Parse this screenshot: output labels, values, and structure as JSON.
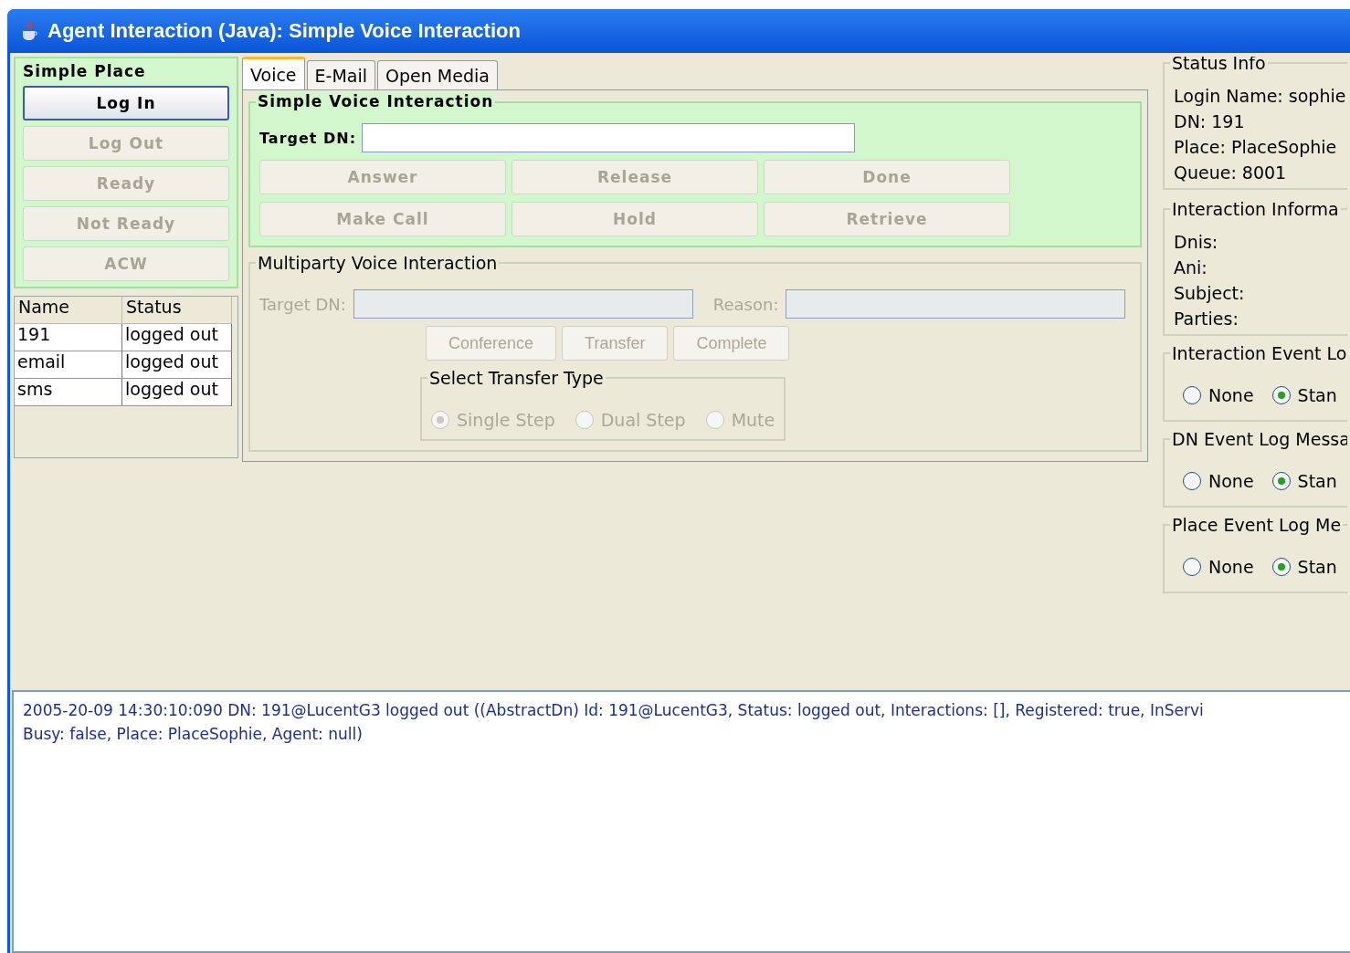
{
  "window": {
    "title": "Agent Interaction (Java): Simple Voice Interaction"
  },
  "place": {
    "title": "Simple Place",
    "buttons": [
      {
        "label": "Log In",
        "disabled": false
      },
      {
        "label": "Log Out",
        "disabled": true
      },
      {
        "label": "Ready",
        "disabled": true
      },
      {
        "label": "Not Ready",
        "disabled": true
      },
      {
        "label": "ACW",
        "disabled": true
      }
    ]
  },
  "dn_table": {
    "columns": [
      "Name",
      "Status"
    ],
    "rows": [
      [
        "191",
        "logged out"
      ],
      [
        "email",
        "logged out"
      ],
      [
        "sms",
        "logged out"
      ]
    ]
  },
  "tabs": [
    {
      "label": "Voice",
      "selected": true
    },
    {
      "label": "E-Mail",
      "selected": false
    },
    {
      "label": "Open Media",
      "selected": false
    }
  ],
  "simple_voice": {
    "title": "Simple Voice Interaction",
    "target_label": "Target DN:",
    "buttons": [
      {
        "label": "Answer",
        "disabled": true
      },
      {
        "label": "Release",
        "disabled": true
      },
      {
        "label": "Done",
        "disabled": true
      },
      {
        "label": "Make Call",
        "disabled": true
      },
      {
        "label": "Hold",
        "disabled": true
      },
      {
        "label": "Retrieve",
        "disabled": true
      }
    ]
  },
  "multiparty": {
    "title": "Multiparty Voice Interaction",
    "target_label": "Target DN:",
    "reason_label": "Reason:",
    "buttons": [
      {
        "label": "Conference",
        "disabled": true
      },
      {
        "label": "Transfer",
        "disabled": true
      },
      {
        "label": "Complete",
        "disabled": true
      }
    ],
    "transfer_type": {
      "title": "Select Transfer Type",
      "options": [
        {
          "label": "Single Step",
          "selected": true,
          "disabled": true
        },
        {
          "label": "Dual Step",
          "selected": false,
          "disabled": true
        },
        {
          "label": "Mute",
          "selected": false,
          "disabled": true
        }
      ]
    }
  },
  "status_info": {
    "title": "Status Info",
    "lines": [
      "Login Name: sophie",
      "DN: 191",
      "Place: PlaceSophie",
      "Queue: 8001"
    ]
  },
  "interaction_info": {
    "title": "Interaction Informa",
    "lines": [
      "Dnis:",
      "Ani:",
      "Subject:",
      "Parties:"
    ]
  },
  "log_groups": [
    {
      "title": "Interaction Event Lo",
      "options": [
        {
          "label": "None",
          "selected": false
        },
        {
          "label": "Stan",
          "selected": true
        }
      ]
    },
    {
      "title": "DN Event Log Messa",
      "options": [
        {
          "label": "None",
          "selected": false
        },
        {
          "label": "Stan",
          "selected": true
        }
      ]
    },
    {
      "title": "Place Event Log Me",
      "options": [
        {
          "label": "None",
          "selected": false
        },
        {
          "label": "Stan",
          "selected": true
        }
      ]
    }
  ],
  "log": [
    "2005-20-09 14:30:10:090 DN: 191@LucentG3   logged out ((AbstractDn) Id: 191@LucentG3, Status: logged out, Interactions: [], Registered: true, InServi",
    "Busy: false, Place: PlaceSophie, Agent: null)"
  ]
}
